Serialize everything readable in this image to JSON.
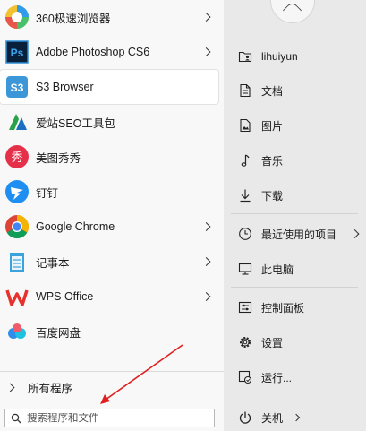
{
  "programs": [
    {
      "label": "360极速浏览器",
      "icon": "360-browser-icon",
      "submenu": true
    },
    {
      "label": "Adobe Photoshop CS6",
      "icon": "photoshop-icon",
      "submenu": true
    },
    {
      "label": "S3 Browser",
      "icon": "s3-browser-icon",
      "submenu": false,
      "selected": true
    },
    {
      "label": "爱站SEO工具包",
      "icon": "aizhan-seo-icon",
      "submenu": false
    },
    {
      "label": "美图秀秀",
      "icon": "meitu-icon",
      "submenu": false
    },
    {
      "label": "钉钉",
      "icon": "dingtalk-icon",
      "submenu": false
    },
    {
      "label": "Google Chrome",
      "icon": "chrome-icon",
      "submenu": true
    },
    {
      "label": "记事本",
      "icon": "notepad-icon",
      "submenu": true
    },
    {
      "label": "WPS Office",
      "icon": "wps-icon",
      "submenu": true
    },
    {
      "label": "百度网盘",
      "icon": "baidu-netdisk-icon",
      "submenu": false
    }
  ],
  "all_programs_label": "所有程序",
  "search": {
    "placeholder": "搜索程序和文件"
  },
  "right": {
    "items": [
      {
        "label": "lihuiyun",
        "icon": "user-folder-icon"
      },
      {
        "label": "文档",
        "icon": "document-icon"
      },
      {
        "label": "图片",
        "icon": "pictures-icon"
      },
      {
        "label": "音乐",
        "icon": "music-icon"
      },
      {
        "label": "下载",
        "icon": "download-icon"
      },
      {
        "label": "最近使用的项目",
        "icon": "recent-icon",
        "submenu": true
      },
      {
        "label": "此电脑",
        "icon": "computer-icon"
      },
      {
        "label": "控制面板",
        "icon": "control-panel-icon"
      },
      {
        "label": "设置",
        "icon": "settings-gear-icon"
      },
      {
        "label": "运行...",
        "icon": "run-icon"
      }
    ],
    "shutdown_label": "关机"
  },
  "colors": {
    "accent": "#e02020",
    "panel_left": "#f8f8f8",
    "panel_right": "#e9e9e9"
  }
}
